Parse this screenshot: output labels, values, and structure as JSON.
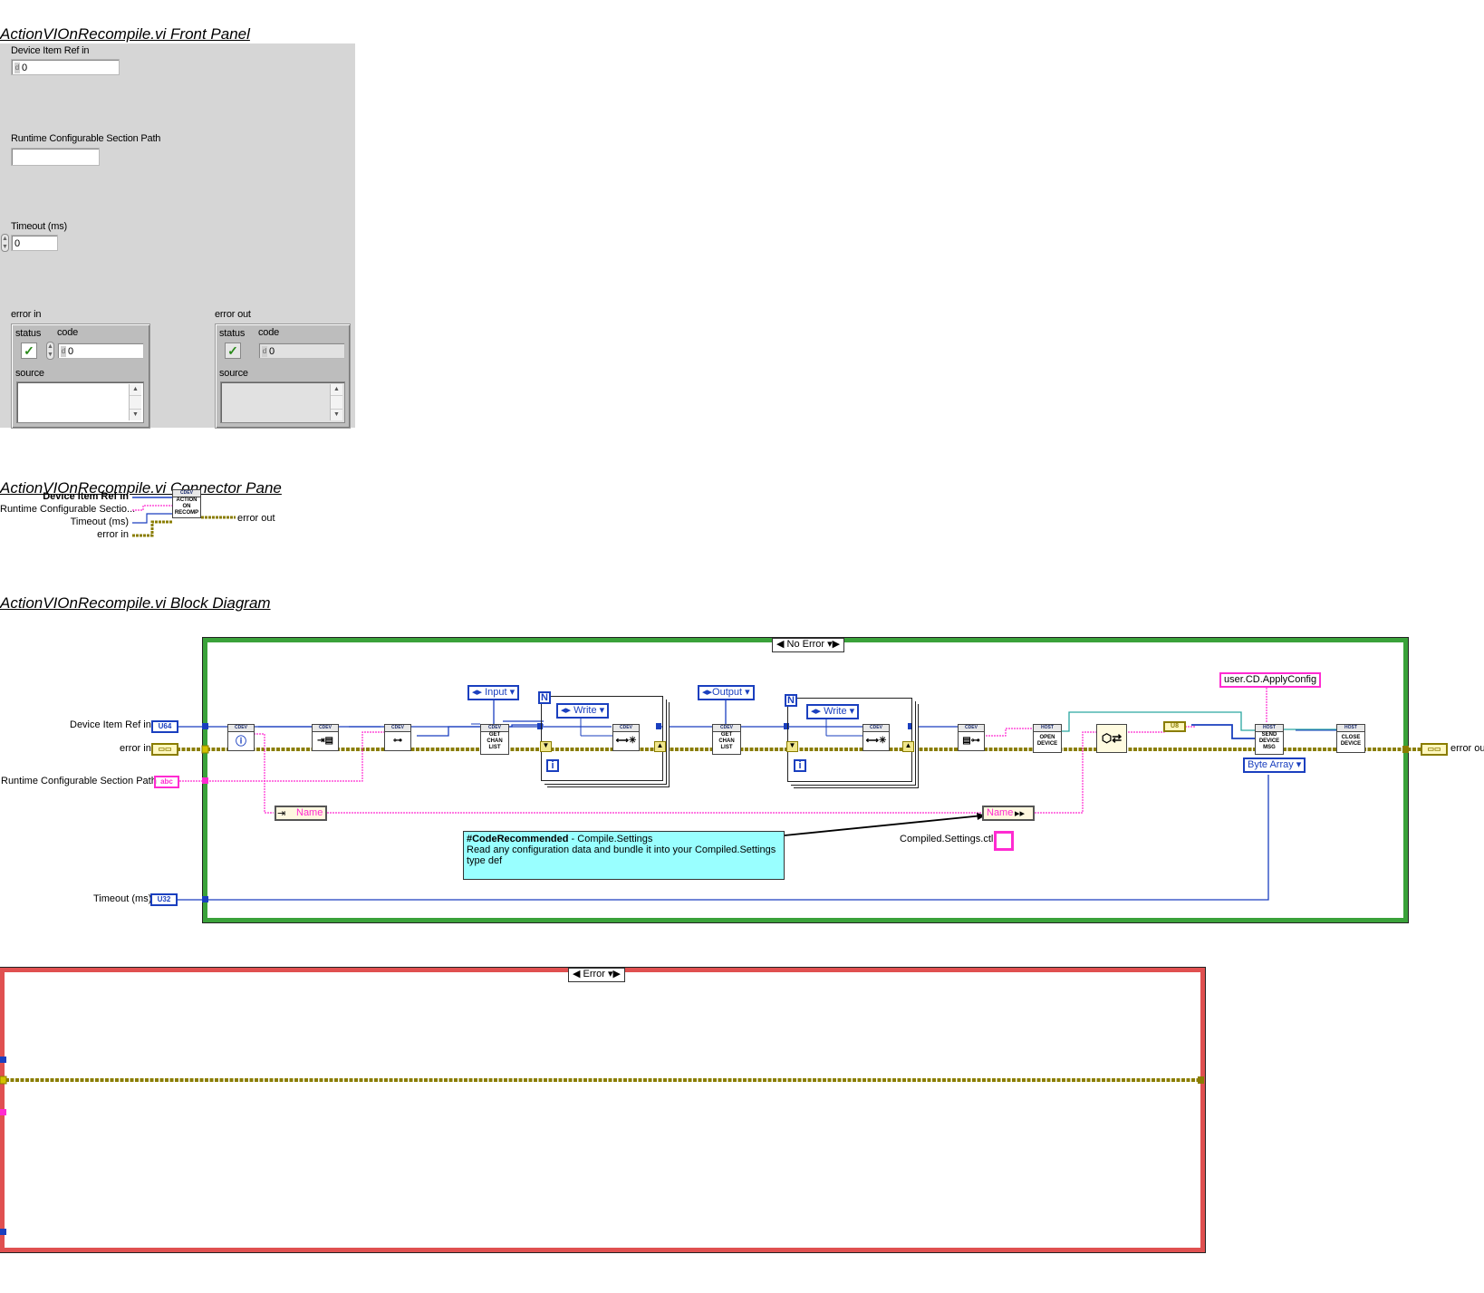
{
  "front_panel": {
    "title": "ActionVIOnRecompile.vi Front Panel",
    "device_item_ref": {
      "label": "Device Item Ref in",
      "value": "0"
    },
    "runtime_path": {
      "label": "Runtime Configurable Section Path",
      "value": ""
    },
    "timeout": {
      "label": "Timeout (ms)",
      "value": "0"
    },
    "error_in": {
      "label": "error in",
      "status_label": "status",
      "code_label": "code",
      "code_value": "0",
      "source_label": "source",
      "status_glyph": "✓"
    },
    "error_out": {
      "label": "error out",
      "status_label": "status",
      "code_label": "code",
      "code_value": "0",
      "source_label": "source",
      "status_glyph": "✓"
    }
  },
  "connector_pane": {
    "title": "ActionVIOnRecompile.vi Connector Pane",
    "inputs": [
      "Device Item Ref in",
      "Runtime Configurable Sectio...",
      "Timeout (ms)",
      "error in"
    ],
    "output": "error out",
    "icon_header": "CDEV",
    "icon_lines": [
      "ACTION",
      "ON",
      "RECOMP"
    ]
  },
  "block_diagram": {
    "title": "ActionVIOnRecompile.vi Block Diagram",
    "case_no_error": "No Error",
    "case_error": "Error",
    "terminals": {
      "device_item_ref": {
        "label": "Device Item Ref in",
        "type": "U64"
      },
      "error_in": {
        "label": "error in",
        "type": "▭▭"
      },
      "runtime_path": {
        "label": "Runtime Configurable Section Path",
        "type": "abc"
      },
      "timeout": {
        "label": "Timeout (ms)",
        "type": "U32"
      },
      "error_out": {
        "label": "error out",
        "type": "▭▭"
      }
    },
    "enums": {
      "input": "Input",
      "output": "Output",
      "write1": "Write",
      "write2": "Write",
      "byte_array": "Byte Array"
    },
    "string_const": "user.CD.ApplyConfig",
    "unbundle_name": "Name",
    "bundle_name": "Name",
    "typedef_label": "Compiled.Settings.ctl",
    "small_const": "U8",
    "nodes": {
      "cdev_header": "CDEV",
      "host_header": "HOST",
      "get_chan_list": [
        "GET",
        "CHAN",
        "LIST"
      ],
      "open_device": [
        "OPEN",
        "DEVICE"
      ],
      "send_device_msg": [
        "SEND",
        "DEVICE",
        "MSG"
      ],
      "close_device": [
        "CLOSE",
        "DEVICE"
      ]
    },
    "loop_count": "N",
    "loop_index": "i",
    "comment": {
      "tag": "#CodeRecommended",
      "subtitle": " - Compile.Settings",
      "body": "Read any configuration data and bundle it into your Compiled.Settings type def"
    }
  },
  "colors": {
    "wire_error": "#8a7d00",
    "wire_ref": "#1a3fbf",
    "wire_string": "#ff2bd1",
    "wire_cluster": "#2aa6a0",
    "case_no_error_border": "#3aa23a",
    "case_error_border": "#e05050"
  }
}
